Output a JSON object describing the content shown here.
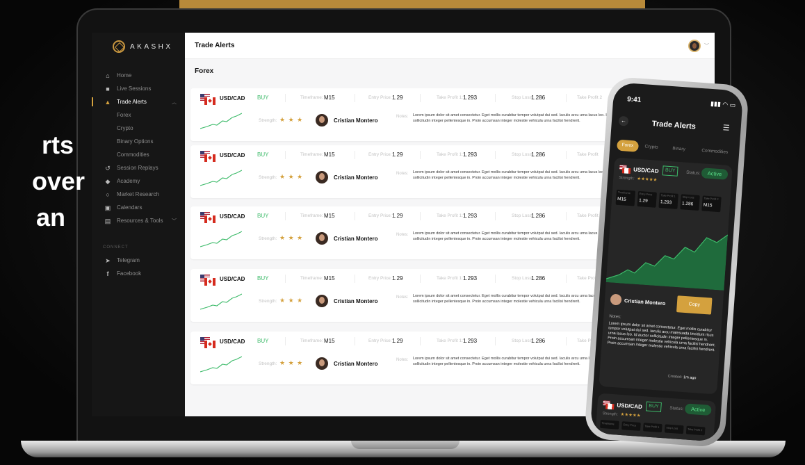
{
  "promo": {
    "line1": "rts",
    "line2": "over",
    "line3": "an"
  },
  "app": {
    "logo": "AKASHX",
    "page_title": "Trade Alerts",
    "section": "Forex"
  },
  "sidebar": {
    "items": [
      {
        "icon": "home-icon",
        "label": "Home"
      },
      {
        "icon": "video-icon",
        "label": "Live Sessions"
      },
      {
        "icon": "bell-icon",
        "label": "Trade Alerts"
      }
    ],
    "sub_items": [
      "Forex",
      "Crypto",
      "Binary Options",
      "Commodities"
    ],
    "items2": [
      {
        "icon": "replay-icon",
        "label": "Session Replays"
      },
      {
        "icon": "graduation-cap-icon",
        "label": "Academy"
      },
      {
        "icon": "search-icon",
        "label": "Market Research"
      },
      {
        "icon": "calendar-icon",
        "label": "Calendars"
      },
      {
        "icon": "book-icon",
        "label": "Resources & Tools"
      }
    ],
    "connect_label": "CONNECT",
    "social": [
      {
        "icon": "telegram-icon",
        "label": "Telegram"
      },
      {
        "icon": "facebook-icon",
        "label": "Facebook"
      }
    ]
  },
  "card_labels": {
    "timeframe": "Timeframe:",
    "entry": "Entry Price:",
    "tp1": "Take Profit 1:",
    "sl": "Stop Loss:",
    "tp2": "Take Profit 2",
    "tp_short": "Take Profit",
    "strength": "Strength:",
    "notes": "Notes:"
  },
  "alerts": [
    {
      "pair": "USD/CAD",
      "side": "BUY",
      "timeframe": "M15",
      "entry": "1.29",
      "tp1": "1.293",
      "sl": "1.286",
      "tp_label": "Take Profit 2",
      "stars": "★ ★ ★",
      "trader": "Cristian Montero",
      "notes": "Lorem ipsum dolor sit amet consectetur. Eget mollis curabitur tempor volutpat dui sed. Iaculis arcu urna lacus leo. Id auctor sollicitudin integer pellentesque in. Proin accumsan integer molestie vehicula urna facilisi hendrerit."
    },
    {
      "pair": "USD/CAD",
      "side": "BUY",
      "timeframe": "M15",
      "entry": "1.29",
      "tp1": "1.293",
      "sl": "1.286",
      "tp_label": "Take Profit",
      "stars": "★ ★ ★",
      "trader": "Cristian Montero",
      "notes": "Lorem ipsum dolor sit amet consectetur. Eget mollis curabitur tempor volutpat dui sed. Iaculis arcu urna lacus leo. Id auctor sollicitudin integer pellentesque in. Proin accumsan integer molestie vehicula urna facilisi hendrerit."
    },
    {
      "pair": "USD/CAD",
      "side": "BUY",
      "timeframe": "M15",
      "entry": "1.29",
      "tp1": "1.293",
      "sl": "1.286",
      "tp_label": "Take Profit",
      "stars": "★ ★ ★",
      "trader": "Cristian Montero",
      "notes": "Lorem ipsum dolor sit amet consectetur. Eget mollis curabitur tempor volutpat dui sed. Iaculis arcu urna lacus leo. Id auctor sollicitudin integer pellentesque in. Proin accumsan integer molestie vehicula urna facilisi hendrerit."
    },
    {
      "pair": "USD/CAD",
      "side": "BUY",
      "timeframe": "M15",
      "entry": "1.29",
      "tp1": "1.293",
      "sl": "1.286",
      "tp_label": "Take Profit",
      "stars": "★ ★ ★",
      "trader": "Cristian Montero",
      "notes": "Lorem ipsum dolor sit amet consectetur. Eget mollis curabitur tempor volutpat dui sed. Iaculis arcu urna lacus leo. Id auctor sollicitudin integer pellentesque in. Proin accumsan integer molestie vehicula urna facilisi hendrerit."
    },
    {
      "pair": "USD/CAD",
      "side": "BUY",
      "timeframe": "M15",
      "entry": "1.29",
      "tp1": "1.293",
      "sl": "1.286",
      "tp_label": "Take Profit",
      "stars": "★ ★ ★",
      "trader": "Cristian Montero",
      "notes": "Lorem ipsum dolor sit amet consectetur. Eget mollis curabitur tempor volutpat dui sed. Iaculis arcu urna lacus leo. Id auctor sollicitudin integer pellentesque in. Proin accumsan integer molestie vehicula urna facilisi hendrerit."
    }
  ],
  "phone": {
    "time": "9:41",
    "status_icons": "▮▮▮ ◠ ▭",
    "title": "Trade Alerts",
    "tabs": [
      "Forex",
      "Crypto",
      "Binary",
      "Commodities"
    ],
    "card": {
      "pair": "USD/CAD",
      "side": "BUY",
      "status_label": "Status:",
      "status": "Active",
      "strength": "Strength:",
      "stars": "★★★★★",
      "fields": [
        {
          "label": "Timeframe",
          "value": "M15"
        },
        {
          "label": "Entry Price",
          "value": "1.29"
        },
        {
          "label": "Take Profit 1",
          "value": "1.293"
        },
        {
          "label": "Stop Loss",
          "value": "1.286"
        },
        {
          "label": "Take Profit 2",
          "value": "M15"
        }
      ],
      "trader": "Cristian Montero",
      "copy": "Copy",
      "notes_label": "Notes:",
      "notes": "Lorem ipsum dolor sit amet consectetur. Eget mollis curabitur tempor volutpat dui sed. Iaculis arcu malesuada tincidunt risus urna lacus leo. Id auctor sollicitudin integer pellentesque in. Proin accumsan integer molestie vehicula urna facilisi hendrerit. Proin accumsan integer molestie vehicula urna facilisi hendrerit.",
      "created_label": "Created:",
      "created": "1m ago"
    },
    "card2": {
      "pair": "USD/CAD",
      "side": "BUY",
      "status_label": "Status:",
      "status": "Active",
      "strength": "Strength:",
      "stars": "★★★★★",
      "fields": [
        "Timeframe",
        "Entry Price",
        "Take Profit 1",
        "Stop Loss",
        "Take Profit 2"
      ]
    }
  },
  "colors": {
    "accent": "#d4a13e",
    "buy": "#3dbb6a",
    "sidebar": "#161616"
  }
}
